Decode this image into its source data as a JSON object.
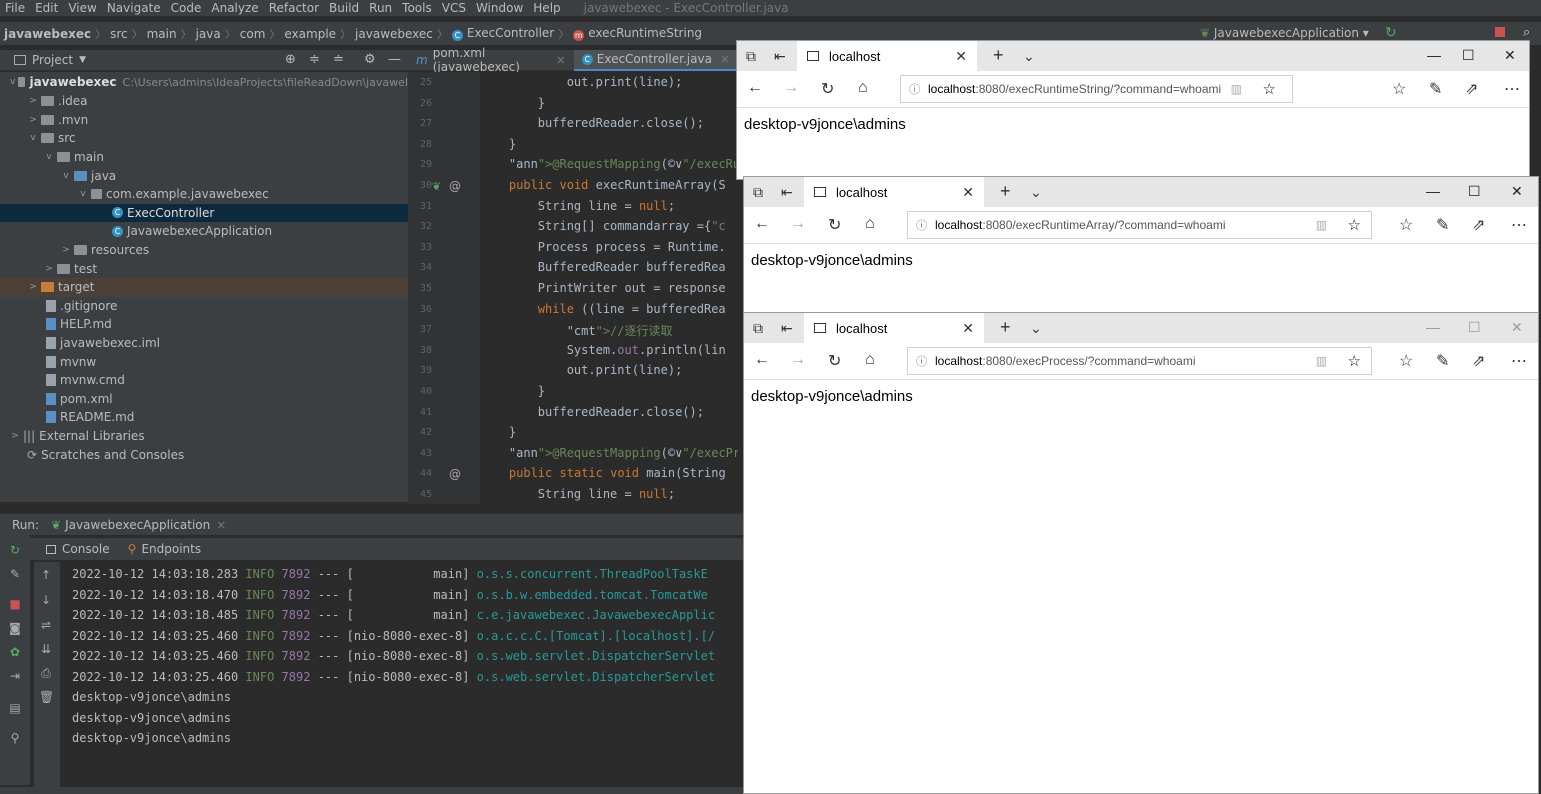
{
  "menu": {
    "items": [
      "File",
      "Edit",
      "View",
      "Navigate",
      "Code",
      "Analyze",
      "Refactor",
      "Build",
      "Run",
      "Tools",
      "VCS",
      "Window",
      "Help"
    ],
    "window_title": "javawebexec - ExecController.java"
  },
  "nav": {
    "crumbs": [
      "javawebexec",
      "src",
      "main",
      "java",
      "com",
      "example",
      "javawebexec",
      "ExecController",
      "execRuntimeString"
    ],
    "run_config": "JavawebexecApplication"
  },
  "project": {
    "header": "Project",
    "root_name": "javawebexec",
    "root_path": "C:\\Users\\admins\\IdeaProjects\\fileReadDown\\javawel",
    "items": [
      {
        "label": ".idea",
        "type": "folder"
      },
      {
        "label": ".mvn",
        "type": "folder"
      },
      {
        "label": "src",
        "type": "folder"
      },
      {
        "label": "main",
        "type": "folder"
      },
      {
        "label": "java",
        "type": "folder-blue"
      },
      {
        "label": "com.example.javawebexec",
        "type": "package"
      },
      {
        "label": "ExecController",
        "type": "class"
      },
      {
        "label": "JavawebexecApplication",
        "type": "class"
      },
      {
        "label": "resources",
        "type": "folder"
      },
      {
        "label": "test",
        "type": "folder"
      },
      {
        "label": "target",
        "type": "folder-orange"
      },
      {
        "label": ".gitignore",
        "type": "file"
      },
      {
        "label": "HELP.md",
        "type": "file"
      },
      {
        "label": "javawebexec.iml",
        "type": "file"
      },
      {
        "label": "mvnw",
        "type": "file"
      },
      {
        "label": "mvnw.cmd",
        "type": "file"
      },
      {
        "label": "pom.xml",
        "type": "file"
      },
      {
        "label": "README.md",
        "type": "file"
      },
      {
        "label": "External Libraries",
        "type": "lib"
      },
      {
        "label": "Scratches and Consoles",
        "type": "scratch"
      }
    ]
  },
  "editor": {
    "tabs": [
      "pom.xml (javawebexec)",
      "ExecController.java"
    ],
    "line_numbers": [
      "25",
      "26",
      "27",
      "28",
      "29",
      "30",
      "31",
      "32",
      "33",
      "34",
      "35",
      "36",
      "37",
      "38",
      "39",
      "40",
      "41",
      "42",
      "43",
      "44",
      "45"
    ],
    "lines": [
      "            out.print(line);",
      "        }",
      "        bufferedReader.close();",
      "    }",
      "    @RequestMapping(©∨\"/execRunti",
      "    public void execRuntimeArray(S",
      "        String line = null;",
      "        String[] commandarray ={\"c",
      "        Process process = Runtime.",
      "        BufferedReader bufferedRea",
      "        PrintWriter out = response",
      "        while ((line = bufferedRea",
      "            //逐行读取",
      "            System.out.println(lin",
      "            out.print(line);",
      "        }",
      "        bufferedReader.close();",
      "    }",
      "    @RequestMapping(©∨\"/execProce",
      "    public static void main(String",
      "        String line = null;"
    ]
  },
  "run": {
    "label": "Run:",
    "config": "JavawebexecApplication",
    "tabs": [
      "Console",
      "Endpoints"
    ],
    "log": [
      {
        "ts": "2022-10-12 14:03:18.283",
        "level": "INFO",
        "pid": "7892",
        "sep": "---",
        "thread": "[           main]",
        "logger": "o.s.s.concurrent.ThreadPoolTaskE"
      },
      {
        "ts": "2022-10-12 14:03:18.470",
        "level": "INFO",
        "pid": "7892",
        "sep": "---",
        "thread": "[           main]",
        "logger": "o.s.b.w.embedded.tomcat.TomcatWe"
      },
      {
        "ts": "2022-10-12 14:03:18.485",
        "level": "INFO",
        "pid": "7892",
        "sep": "---",
        "thread": "[           main]",
        "logger": "c.e.javawebexec.JavawebexecApplic"
      },
      {
        "ts": "2022-10-12 14:03:25.460",
        "level": "INFO",
        "pid": "7892",
        "sep": "---",
        "thread": "[nio-8080-exec-8]",
        "logger": "o.a.c.c.C.[Tomcat].[localhost].[/"
      },
      {
        "ts": "2022-10-12 14:03:25.460",
        "level": "INFO",
        "pid": "7892",
        "sep": "---",
        "thread": "[nio-8080-exec-8]",
        "logger": "o.s.web.servlet.DispatcherServlet"
      },
      {
        "ts": "2022-10-12 14:03:25.460",
        "level": "INFO",
        "pid": "7892",
        "sep": "---",
        "thread": "[nio-8080-exec-8]",
        "logger": "o.s.web.servlet.DispatcherServlet"
      }
    ],
    "output": [
      "desktop-v9jonce\\admins",
      "desktop-v9jonce\\admins",
      "desktop-v9jonce\\admins"
    ]
  },
  "browsers": [
    {
      "tab_title": "localhost",
      "host": "localhost",
      "path": ":8080/execRuntimeString/?command=whoami",
      "result": "desktop-v9jonce\\admins"
    },
    {
      "tab_title": "localhost",
      "host": "localhost",
      "path": ":8080/execRuntimeArray/?command=whoami",
      "result": "desktop-v9jonce\\admins"
    },
    {
      "tab_title": "localhost",
      "host": "localhost",
      "path": ":8080/execProcess/?command=whoami",
      "result": "desktop-v9jonce\\admins"
    }
  ]
}
